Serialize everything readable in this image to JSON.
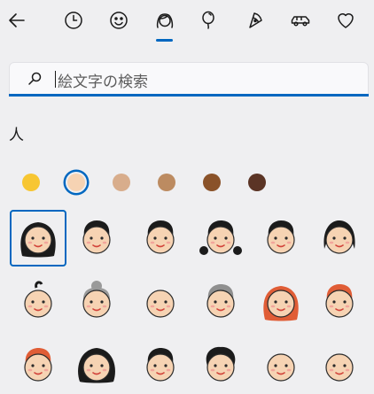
{
  "search": {
    "placeholder": "絵文字の検索"
  },
  "section": {
    "title": "人"
  },
  "nav": {
    "tabs": [
      {
        "name": "back-arrow-icon"
      },
      {
        "name": "recent-clock-icon"
      },
      {
        "name": "smiley-icon"
      },
      {
        "name": "people-icon",
        "selected": true
      },
      {
        "name": "balloon-icon"
      },
      {
        "name": "pizza-icon"
      },
      {
        "name": "car-icon"
      },
      {
        "name": "heart-icon"
      }
    ]
  },
  "skin_tones": [
    {
      "name": "default-yellow",
      "color": "#f7c632"
    },
    {
      "name": "light",
      "color": "#f6d3b3",
      "selected": true
    },
    {
      "name": "medium-light",
      "color": "#d8ad8c"
    },
    {
      "name": "medium",
      "color": "#bc8b61"
    },
    {
      "name": "medium-dark",
      "color": "#8a5229"
    },
    {
      "name": "dark",
      "color": "#5b3425"
    }
  ],
  "colors": {
    "accent": "#0067c0",
    "background": "#efeff1"
  },
  "emoji_grid": [
    {
      "name": "woman-emoji",
      "selected": true
    },
    {
      "name": "man-emoji"
    },
    {
      "name": "person-emoji"
    },
    {
      "name": "girl-emoji"
    },
    {
      "name": "boy-emoji"
    },
    {
      "name": "child-emoji"
    },
    {
      "name": "baby-emoji"
    },
    {
      "name": "old-woman-emoji"
    },
    {
      "name": "old-man-emoji"
    },
    {
      "name": "older-person-emoji"
    },
    {
      "name": "woman-red-hair-emoji"
    },
    {
      "name": "man-red-hair-emoji"
    },
    {
      "name": "person-red-hair-emoji"
    },
    {
      "name": "woman-curly-hair-emoji"
    },
    {
      "name": "man-curly-hair-emoji"
    },
    {
      "name": "person-curly-hair-emoji"
    },
    {
      "name": "woman-bald-emoji"
    },
    {
      "name": "man-bald-emoji"
    }
  ]
}
